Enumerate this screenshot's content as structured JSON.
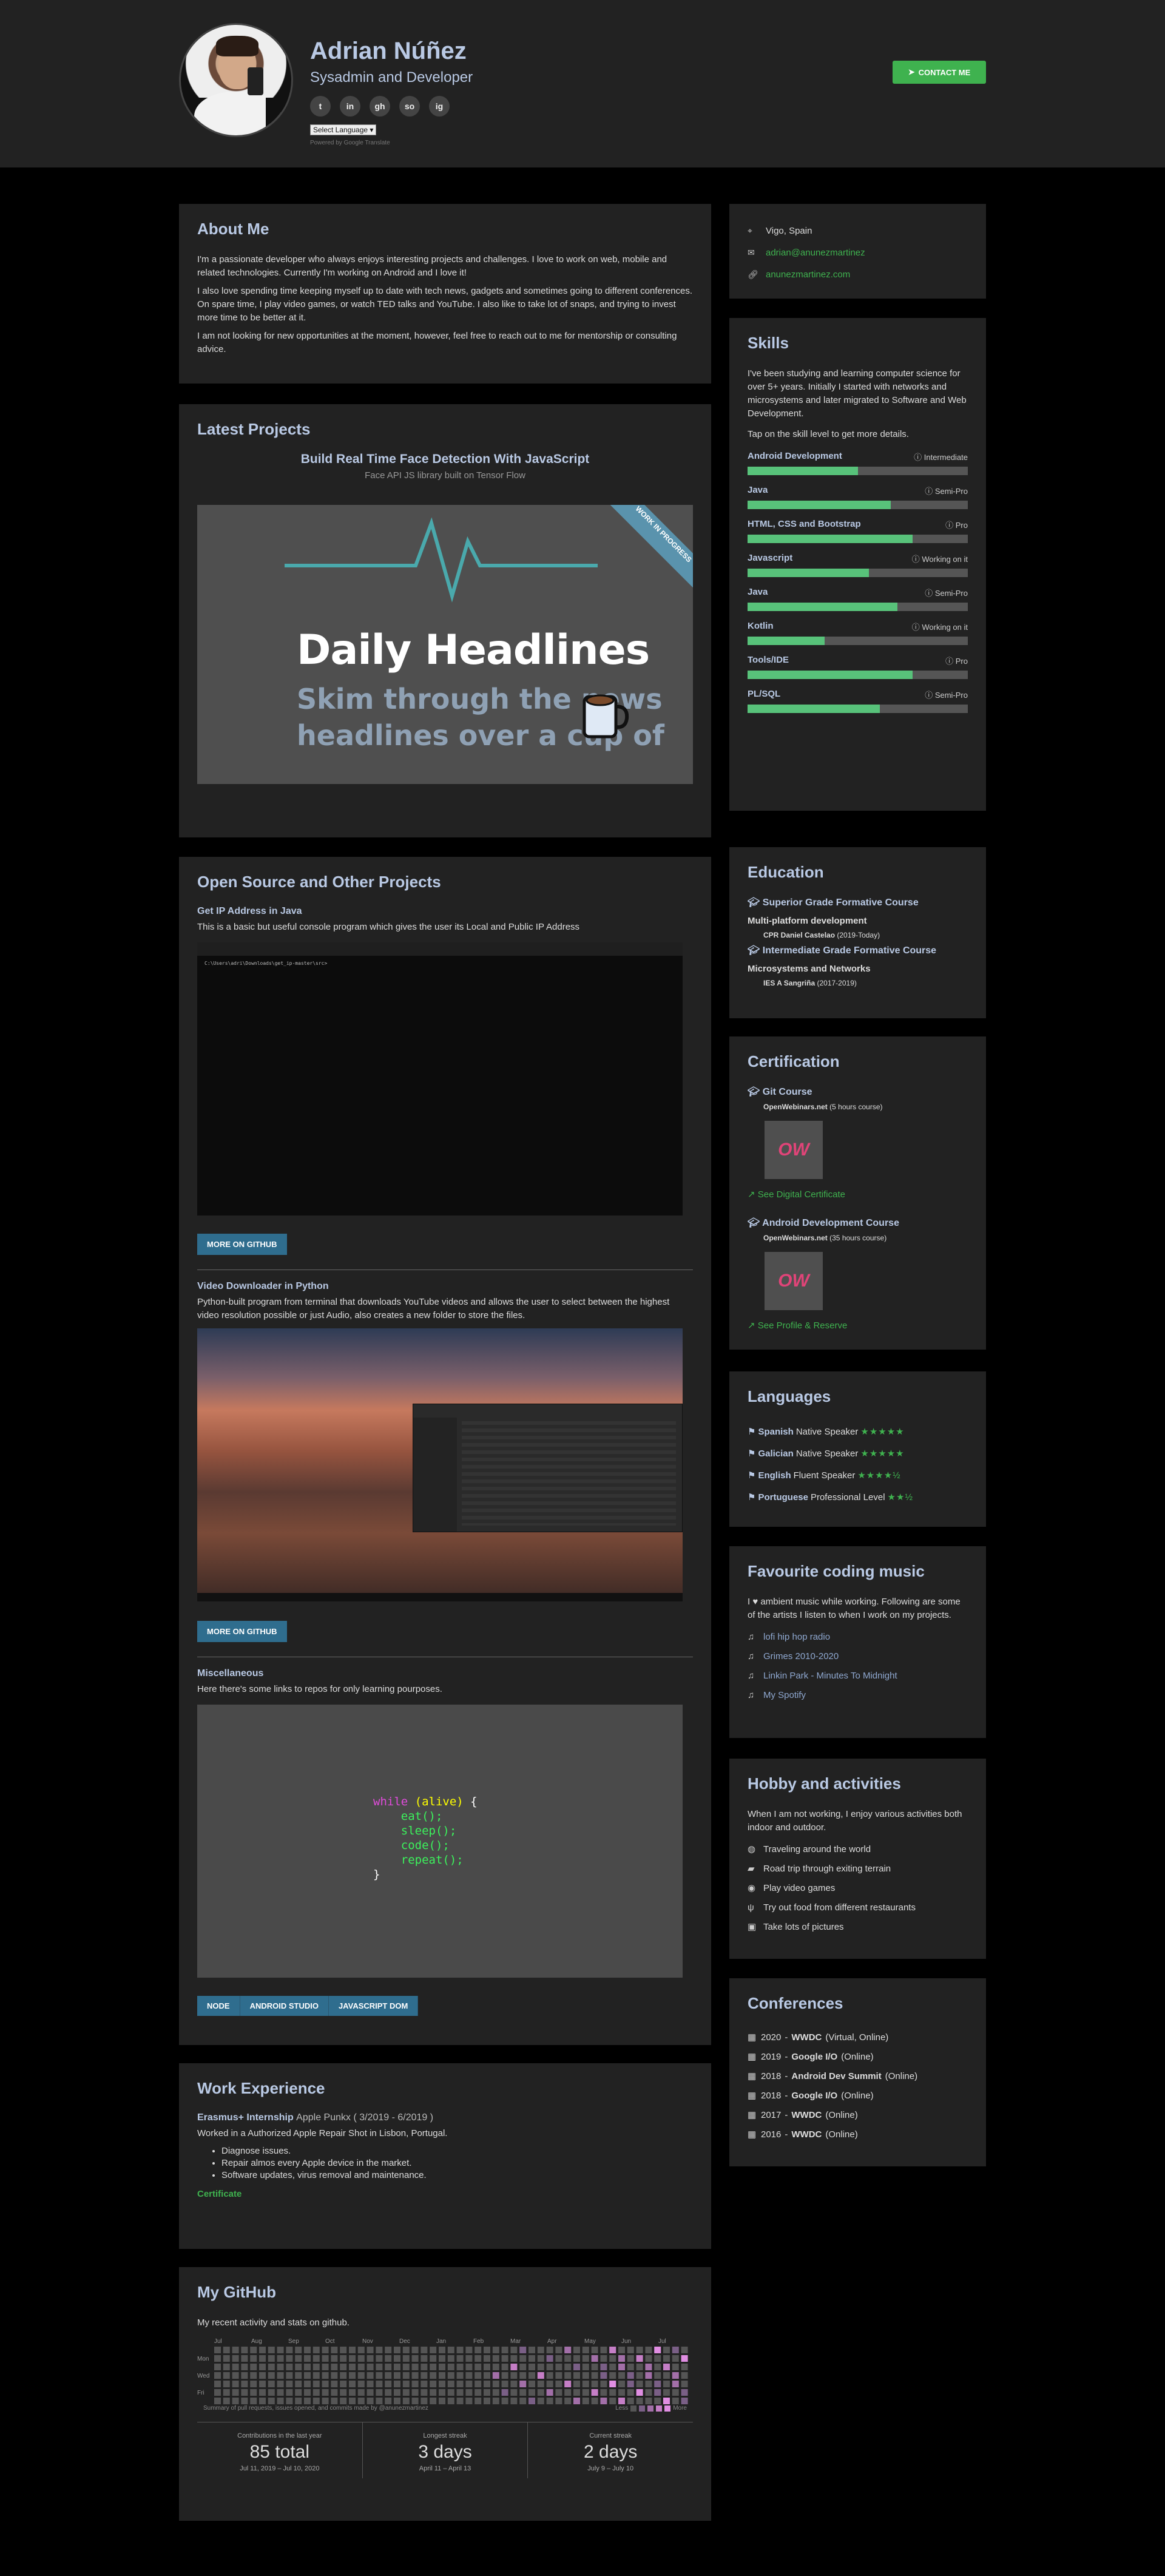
{
  "header": {
    "name": "Adrian Núñez",
    "role": "Sysadmin and Developer",
    "socials": [
      {
        "icon": "twitter-icon",
        "glyph": "t"
      },
      {
        "icon": "linkedin-icon",
        "glyph": "in"
      },
      {
        "icon": "github-icon",
        "glyph": "gh"
      },
      {
        "icon": "stackoverflow-icon",
        "glyph": "so"
      },
      {
        "icon": "instagram-icon",
        "glyph": "ig"
      }
    ],
    "language_select": "Select Language",
    "powered_by": "Powered by Google Translate",
    "contact_label": "CONTACT ME"
  },
  "about": {
    "title": "About Me",
    "p1": "I'm a passionate developer who always enjoys interesting projects and challenges. I love to work on web, mobile and related technologies. Currently I'm working on Android and I love it!",
    "p2": "I also love spending time keeping myself up to date with tech news, gadgets and sometimes going to different conferences. On spare time, I play video games, or watch TED talks and YouTube. I also like to take lot of snaps, and trying to invest more time to be better at it.",
    "p3": "I am not looking for new opportunities at the moment, however, feel free to reach out to me for mentorship or consulting advice."
  },
  "contact": {
    "location": "Vigo, Spain",
    "email": "adrian@anunezmartinez",
    "website": "anunezmartinez.com"
  },
  "latest": {
    "title": "Latest Projects",
    "project_title": "Build Real Time Face Detection With JavaScript",
    "project_sub": "Face API JS library built on Tensor Flow",
    "ribbon": "WORK IN PROGRESS",
    "headline": "Daily Headlines",
    "tagline1": "Skim through the news",
    "tagline2": "headlines over a cup of"
  },
  "opensource": {
    "title": "Open Source and Other Projects",
    "p1_title": "Get IP Address in Java",
    "p1_desc": "This is a basic but useful console program which gives the user its Local and Public IP Address",
    "p1_term": "C:\\Users\\adri\\Downloads\\get_ip-master\\src>",
    "github_btn": "MORE ON GITHUB",
    "p2_title": "Video Downloader in Python",
    "p2_desc": "Python-built program from terminal that downloads YouTube videos and allows the user to select between the highest video resolution possible or just Audio, also creates a new folder to store the files.",
    "p3_title": "Miscellaneous",
    "p3_desc": "Here there's some links to repos for only learning pourposes.",
    "code": {
      "l1a": "while",
      "l1b": "(alive)",
      "l1c": " {",
      "l2": "eat();",
      "l3": "sleep();",
      "l4": "code();",
      "l5": "repeat();",
      "l6": "}"
    },
    "tags": [
      "NODE",
      "ANDROID STUDIO",
      "JAVASCRIPT DOM"
    ]
  },
  "work": {
    "title": "Work Experience",
    "role": "Erasmus+ Internship",
    "company": "Apple Punkx ( 3/2019 - 6/2019 )",
    "desc": "Worked in a Authorized Apple Repair Shot in Lisbon, Portugal.",
    "bullets": [
      "Diagnose issues.",
      "Repair almos every Apple device in the market.",
      "Software updates, virus removal and maintenance."
    ],
    "certificate": "Certificate"
  },
  "github": {
    "title": "My GitHub",
    "desc": "My recent activity and stats on github.",
    "months": [
      "Jul",
      "Aug",
      "Sep",
      "Oct",
      "Nov",
      "Dec",
      "Jan",
      "Feb",
      "Mar",
      "Apr",
      "May",
      "Jun",
      "Jul"
    ],
    "days": [
      "Mon",
      "Wed",
      "Fri"
    ],
    "summary": "Summary of pull requests, issues opened, and commits made by @anunezmartinez",
    "less": "Less",
    "more": "More",
    "stats": [
      {
        "label": "Contributions in the last year",
        "value": "85 total",
        "dates": "Jul 11, 2019 – Jul 10, 2020"
      },
      {
        "label": "Longest streak",
        "value": "3 days",
        "dates": "April 11 – April 13"
      },
      {
        "label": "Current streak",
        "value": "2 days",
        "dates": "July 9 – July 10"
      }
    ]
  },
  "skills": {
    "title": "Skills",
    "intro": "I've been studying and learning computer science for over 5+ years. Initially I started with networks and microsystems and later migrated to Software and Web Development.",
    "tap": "Tap on the skill level to get more details.",
    "items": [
      {
        "name": "Android Development",
        "level": "Intermediate",
        "pct": 50
      },
      {
        "name": "Java",
        "level": "Semi-Pro",
        "pct": 65
      },
      {
        "name": "HTML, CSS and Bootstrap",
        "level": "Pro",
        "pct": 75
      },
      {
        "name": "Javascript",
        "level": "Working on it",
        "pct": 55
      },
      {
        "name": "Java",
        "level": "Semi-Pro",
        "pct": 68
      },
      {
        "name": "Kotlin",
        "level": "Working on it",
        "pct": 35
      },
      {
        "name": "Tools/IDE",
        "level": "Pro",
        "pct": 75
      },
      {
        "name": "PL/SQL",
        "level": "Semi-Pro",
        "pct": 60
      }
    ]
  },
  "education": {
    "title": "Education",
    "items": [
      {
        "grade": "Superior Grade Formative Course",
        "subject": "Multi-platform development",
        "place": "CPR Daniel Castelao",
        "years": "(2019-Today)"
      },
      {
        "grade": "Intermediate Grade Formative Course",
        "subject": "Microsystems and Networks",
        "place": "IES A Sangriña",
        "years": "(2017-2019)"
      }
    ]
  },
  "certification": {
    "title": "Certification",
    "items": [
      {
        "name": "Git Course",
        "provider": "OpenWebinars.net",
        "hours": "(5 hours course)",
        "link": "See Digital Certificate"
      },
      {
        "name": "Android Development Course",
        "provider": "OpenWebinars.net",
        "hours": "(35 hours course)",
        "link": "See Profile & Reserve"
      }
    ],
    "logo_text": "OW"
  },
  "languages": {
    "title": "Languages",
    "items": [
      {
        "lang": "Spanish",
        "level": "Native Speaker",
        "stars": "★★★★★"
      },
      {
        "lang": "Galician",
        "level": "Native Speaker",
        "stars": "★★★★★"
      },
      {
        "lang": "English",
        "level": "Fluent Speaker",
        "stars": "★★★★½"
      },
      {
        "lang": "Portuguese",
        "level": "Professional Level",
        "stars": "★★½"
      }
    ]
  },
  "music": {
    "title": "Favourite coding music",
    "intro": "I ♥ ambient music while working. Following are some of the artists I listen to when I work on my projects.",
    "items": [
      "lofi hip hop radio",
      "Grimes 2010-2020",
      "Linkin Park - Minutes To Midnight",
      "My Spotify"
    ]
  },
  "hobby": {
    "title": "Hobby and activities",
    "intro": "When I am not working, I enjoy various activities both indoor and outdoor.",
    "items": [
      {
        "icon": "globe-icon",
        "glyph": "◍",
        "text": "Traveling around the world"
      },
      {
        "icon": "car-icon",
        "glyph": "▰",
        "text": "Road trip through exiting terrain"
      },
      {
        "icon": "gamepad-icon",
        "glyph": "◉",
        "text": "Play video games"
      },
      {
        "icon": "cutlery-icon",
        "glyph": "ψ",
        "text": "Try out food from different restaurants"
      },
      {
        "icon": "camera-icon",
        "glyph": "▣",
        "text": "Take lots of pictures"
      }
    ]
  },
  "conferences": {
    "title": "Conferences",
    "items": [
      {
        "year": "2020",
        "name": "WWDC",
        "mode": "(Virtual, Online)"
      },
      {
        "year": "2019",
        "name": "Google I/O",
        "mode": "(Online)"
      },
      {
        "year": "2018",
        "name": "Android Dev Summit",
        "mode": "(Online)"
      },
      {
        "year": "2018",
        "name": "Google I/O",
        "mode": "(Online)"
      },
      {
        "year": "2017",
        "name": "WWDC",
        "mode": "(Online)"
      },
      {
        "year": "2016",
        "name": "WWDC",
        "mode": "(Online)"
      }
    ]
  }
}
